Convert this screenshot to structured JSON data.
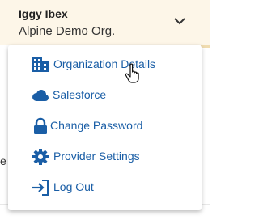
{
  "header": {
    "user_name": "Iggy Ibex",
    "org_name": "Alpine Demo Org.",
    "toggle_icon": "chevron-down-icon"
  },
  "background": {
    "partial_text": "e"
  },
  "menu": {
    "items": [
      {
        "label": "Organization Details",
        "icon": "building-icon"
      },
      {
        "label": "Salesforce",
        "icon": "cloud-icon"
      },
      {
        "label": "Change Password",
        "icon": "lock-icon"
      },
      {
        "label": "Provider Settings",
        "icon": "gear-icon"
      },
      {
        "label": "Log Out",
        "icon": "logout-icon"
      }
    ]
  },
  "colors": {
    "header_bg": "#fdf6e8",
    "link": "#1a5ea6",
    "icon": "#1a5ea6"
  }
}
